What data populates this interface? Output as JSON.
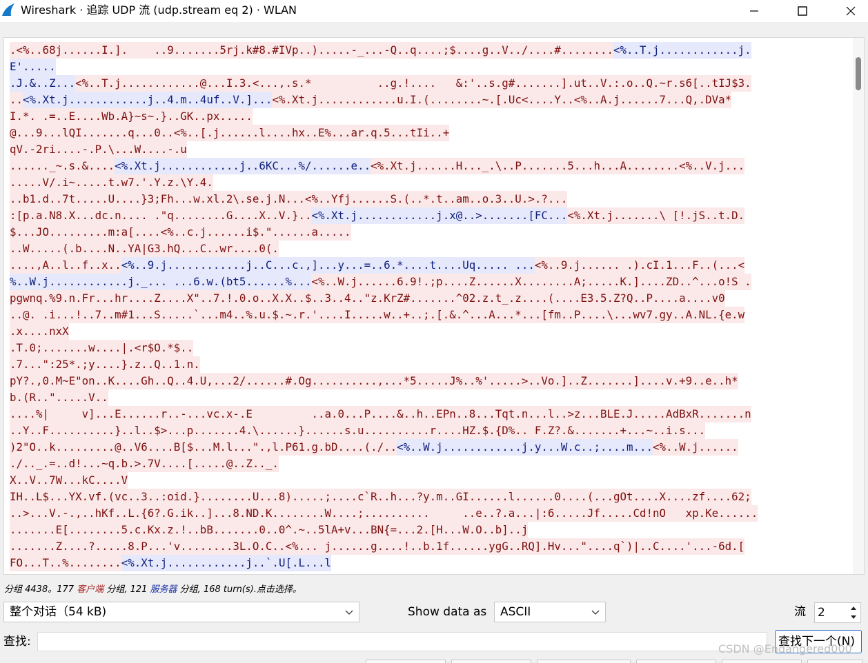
{
  "window": {
    "title": "Wireshark · 追踪 UDP 流 (udp.stream eq 2) · WLAN",
    "controls": [
      "minimize-icon",
      "maximize-icon",
      "close-icon"
    ]
  },
  "stream": {
    "lines": [
      [
        {
          "t": ".<%..68j......I.].    ..9.......5rj.k#8.#IVp..).....-_...-Q..q....;$....g..V../....#........",
          "s": "client"
        },
        {
          "t": "<%..T.j............j.",
          "s": "server"
        }
      ],
      [
        {
          "t": "E'.....",
          "s": "server"
        }
      ],
      [
        {
          "t": ".J.&..Z...",
          "s": "server"
        },
        {
          "t": "<%..T.j............@...I.3.<...,.s.*          ..g.!....   &:'..s.g#.......].ut..V.:.o..Q.~r.s6[..tIJ$3.",
          "s": "client"
        }
      ],
      [
        {
          "t": "..",
          "s": "client"
        },
        {
          "t": "<%.Xt.j............j..4.m..4uf..V.]...",
          "s": "server"
        },
        {
          "t": "<%.Xt.j............u.I.(........~.[.Uc<....Y..<%..A.j......7...Q,.DVa*",
          "s": "client"
        }
      ],
      [
        {
          "t": "I.*. .=..E....Wb.A}~s~.}..GK..px.....",
          "s": "client"
        }
      ],
      [
        {
          "t": "@...9...lQI.......q...0..<%..[.j......l....hx..E%...ar.q.5...tIi..+",
          "s": "client"
        }
      ],
      [
        {
          "t": "qV.-2ri....-.P.\\...W....-.u",
          "s": "client"
        }
      ],
      [
        {
          "t": "......_~.s.&....",
          "s": "client"
        },
        {
          "t": "<%.Xt.j............j..6KC...%/......e..",
          "s": "server"
        },
        {
          "t": "<%.Xt.j......H..._.\\..P.......5...h...A........<%..V.j...",
          "s": "client"
        }
      ],
      [
        {
          "t": ".....V/.i~.....t.w7.'.Y.z.\\Y.4.",
          "s": "client"
        }
      ],
      [
        {
          "t": "..b1.d..7t.....U....}3;Fh...w.xl.2\\.se.j.N...<%..Yfj......S.(..*.t..am..o.3..U.>.?...",
          "s": "client"
        }
      ],
      [
        {
          "t": ":[p.a.N8.X...dc.n.... .\"q........G....X..V.}..",
          "s": "client"
        },
        {
          "t": "<%.Xt.j............j.x@..>.......[FC...",
          "s": "server"
        },
        {
          "t": "<%.Xt.j.......\\ [!.jS..t.D.",
          "s": "client"
        }
      ],
      [
        {
          "t": "$...JO.........m:a[....<%..c.j......i$.\"......a.....",
          "s": "client"
        }
      ],
      [
        {
          "t": "..W.....(.b....N..YA|G3.hQ...C..wr....0(.",
          "s": "client"
        }
      ],
      [
        {
          "t": "....,A..l..f..x..",
          "s": "client"
        },
        {
          "t": "<%..9.j............j..C...c.,]...y...=..6.*....t....Uq..... ...",
          "s": "server"
        },
        {
          "t": "<%..9.j...... .).cI.1...F..(...<",
          "s": "client"
        }
      ],
      [
        {
          "t": "%..W.j............j._... ...6.w.(bt5......%...",
          "s": "server"
        },
        {
          "t": "<%..W.j......6.9!.;p....Z......X........A;.....K.]....ZD..^...o!S .",
          "s": "client"
        }
      ],
      [
        {
          "t": "pgwnq.%9.n.Fr...hr....Z....X\"..7.!.0.o..X.X..$..3..4..\"z.KrZ#.......^02.z.t_.z....(....E3.5.Z?Q..P....a....v0",
          "s": "client"
        }
      ],
      [
        {
          "t": "..@. .i...!..7..m#1...S.....`...m4..%.u.$.~.r.'....I.....w..+..;.[.&.^...A...*...[fm..P....\\...wv7.gy..A.NL.{e.w",
          "s": "client"
        }
      ],
      [
        {
          "t": ".x....nxX",
          "s": "client"
        }
      ],
      [
        {
          "t": ".T.0;.......w....|.<r$O.*$..",
          "s": "client"
        }
      ],
      [
        {
          "t": ".7...\":25*.;y....}.z..Q..1.n.",
          "s": "client"
        }
      ],
      [
        {
          "t": "pY?.,0.M~E\"on..K....Gh..Q..4.U,...2/......#.Og..........,...*5.....J%..%'.....>..Vo.]..Z.......]....v.+9..e..h*",
          "s": "client"
        }
      ],
      [
        {
          "t": "b.(R..\".....V..",
          "s": "client"
        }
      ],
      [
        {
          "t": "....%|     v]...E......r..-...vc.x-.E         ..a.0...P....&..h..EPn..8...Tqt.n...l..>z...BLE.J.....AdBxR.......n",
          "s": "client"
        }
      ],
      [
        {
          "t": "..Y..F..........}..l..$>...p.......4.\\......}......s.u..........r....HZ.$.{D%.. F.Z?.&.......+...~..i.s...",
          "s": "client"
        }
      ],
      [
        {
          "t": ")2\"O..k.........@..V6....B[$...M.l...\".,l.P61.g.bD....(./..",
          "s": "client"
        },
        {
          "t": "<%..W.j............j.y...W.c..;....m...",
          "s": "server"
        },
        {
          "t": "<%..W.j......",
          "s": "client"
        }
      ],
      [
        {
          "t": "./.._.=..d!...~q.b.>.7V....[.....@..Z.._.",
          "s": "client"
        }
      ],
      [
        {
          "t": "X..V..7W...kC....V",
          "s": "client"
        }
      ],
      [
        {
          "t": "IH..L$...YX.vf.(vc..3..:oid.}........U...8).....;....c`R..h...?y.m..GI......l......0....(...gOt....X....zf....62;",
          "s": "client"
        }
      ],
      [
        {
          "t": "..>...V.-.,..hKf..L.{6?.G.ik..]...8.ND.K........W....;..........     ..e..?.a...|:6.....Jf.....Cd!nO   xp.Ke......",
          "s": "client"
        }
      ],
      [
        {
          "t": ".......E[........5.c.Kx.z.!..bB.......0..0^.~..5lA+v...BN{=...2.[H...W.O..b]..j",
          "s": "client"
        }
      ],
      [
        {
          "t": ".......Z....?.....8.P...'v........3L.O.C..<%... j......g....!..b.1f......ygG..RQ].Hv...\"....q`)|..C....'...-6d.[",
          "s": "client"
        }
      ],
      [
        {
          "t": "FO...T..%........",
          "s": "client"
        },
        {
          "t": "<%.Xt.j............j..`.U[.L...l",
          "s": "server"
        }
      ]
    ]
  },
  "status": {
    "prefix": "分组 4438。177 ",
    "client_word": "客户端",
    "middle": " 分组, 121 ",
    "server_word": "服务器",
    "suffix": " 分组, 168 turn(s).点击选择。"
  },
  "controls": {
    "conversation_select": "整个对话（54 kB)",
    "show_data_label": "Show data as",
    "show_data_value": "ASCII",
    "stream_label": "流",
    "stream_value": "2",
    "find_label": "查找:",
    "find_value": "",
    "find_next_label": "查找下一个(N)"
  },
  "watermark": "CSDN @Endangered000",
  "colors": {
    "client_bg": "#fbe9e9",
    "client_fg": "#7d0f0f",
    "server_bg": "#e6e9fb",
    "server_fg": "#0f1f7d",
    "accent": "#2f6fc7"
  }
}
